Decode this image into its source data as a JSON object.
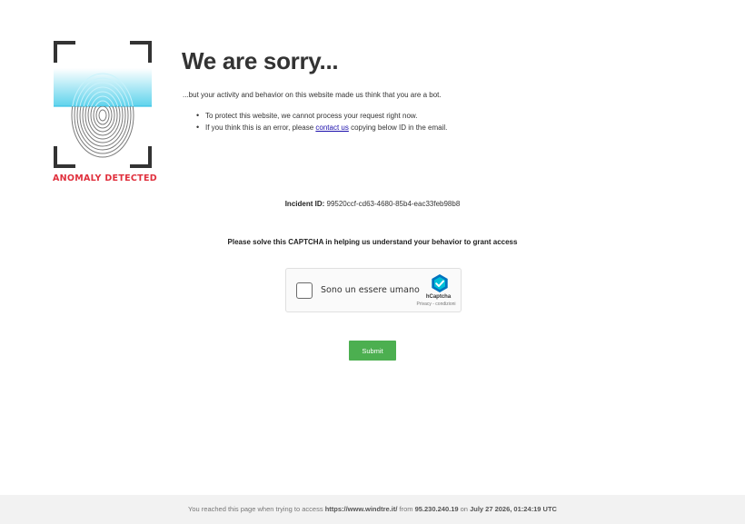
{
  "logo": {
    "label": "ANOMALY DETECTED"
  },
  "heading": "We are sorry...",
  "intro": "...but your activity and behavior on this website made us think that you are a bot.",
  "bullets": {
    "item1": "To protect this website, we cannot process your request right now.",
    "item2_prefix": "If you think this is an error, please ",
    "item2_link": "contact us",
    "item2_suffix": " copying below ID in the email."
  },
  "incident": {
    "label": "Incident ID:",
    "value": " 99520ccf-cd63-4680-85b4-eac33feb98b8"
  },
  "instruction": "Please solve this CAPTCHA in helping us understand your behavior to grant access",
  "captcha": {
    "checkbox_label": "Sono un essere umano",
    "brand": "hCaptcha",
    "links": "Privacy - condizioni"
  },
  "submit_label": "Submit",
  "footer": {
    "prefix": "You reached this page when trying to access ",
    "url": "https://www.windtre.it/",
    "from_text": " from ",
    "ip": "95.230.240.19",
    "on_text": " on ",
    "datetime": "July 27 2026, 01:24:19 UTC"
  },
  "colors": {
    "accent_green": "#4caf50",
    "anomaly_red": "#e0303d",
    "link_blue": "#1a0dab",
    "fingerprint_cyan": "#5fd3ec"
  },
  "icons": [
    "fingerprint-icon",
    "hcaptcha-logo-icon"
  ]
}
